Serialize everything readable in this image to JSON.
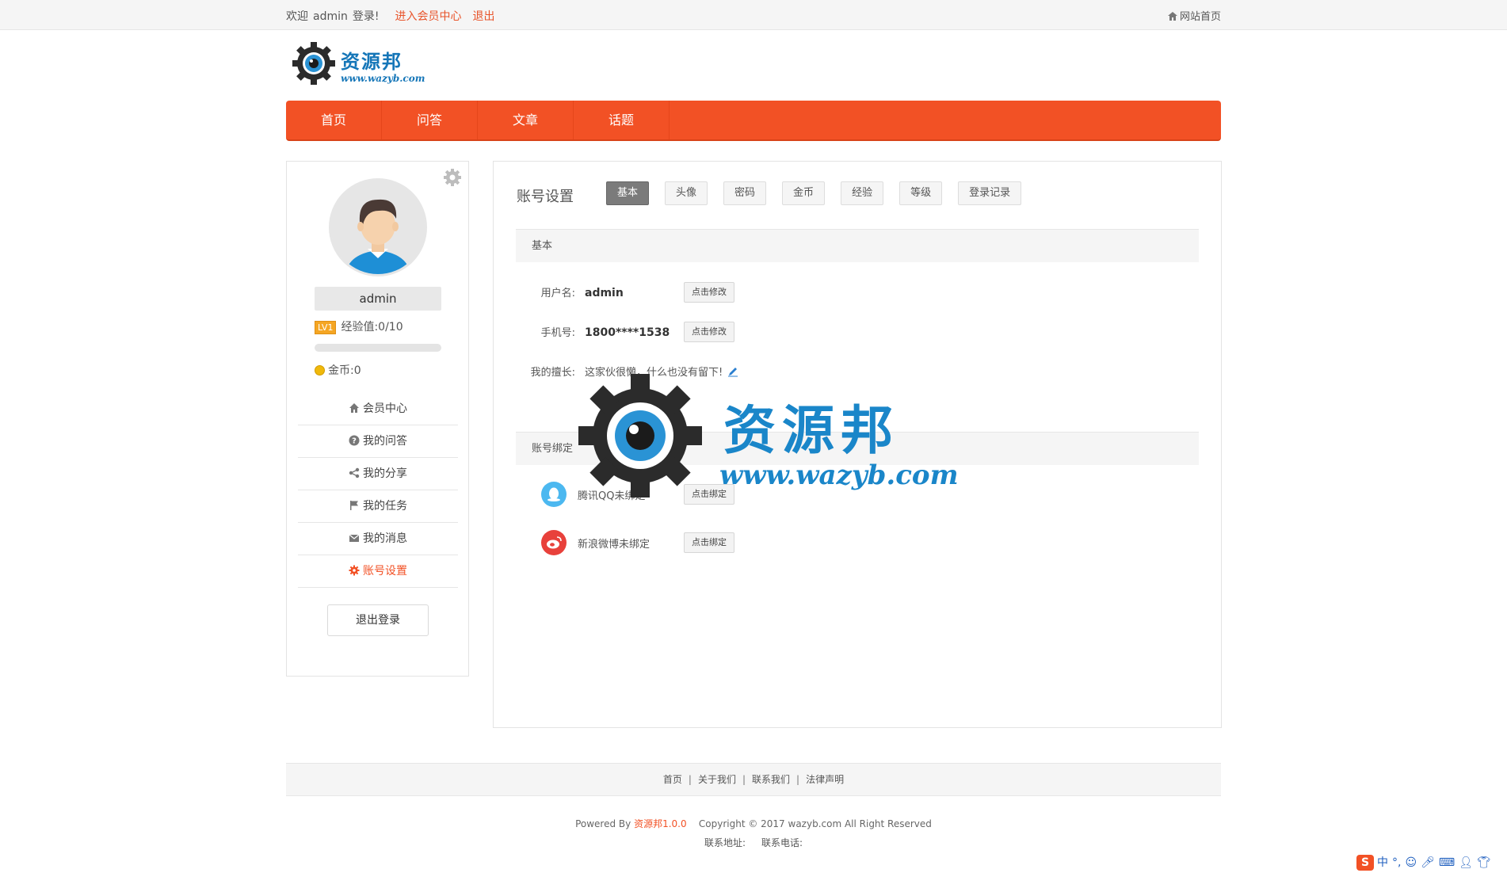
{
  "topbar": {
    "welcome": "欢迎",
    "user": "admin",
    "login_suffix": "登录!",
    "member_center_link": "进入会员中心",
    "logout_link": "退出",
    "site_home": "网站首页"
  },
  "logo": {
    "name": "资源邦",
    "url": "www.wazyb.com"
  },
  "nav": {
    "items": [
      {
        "label": "首页"
      },
      {
        "label": "问答"
      },
      {
        "label": "文章"
      },
      {
        "label": "话题"
      }
    ]
  },
  "sidebar": {
    "username": "admin",
    "level_badge": "LV1",
    "exp_label": "经验值:0/10",
    "exp_fraction": 0.0,
    "coin_label": "金币:0",
    "menu": [
      {
        "label": "会员中心",
        "icon": "home-icon"
      },
      {
        "label": "我的问答",
        "icon": "question-icon"
      },
      {
        "label": "我的分享",
        "icon": "share-icon"
      },
      {
        "label": "我的任务",
        "icon": "flag-icon"
      },
      {
        "label": "我的消息",
        "icon": "mail-icon"
      },
      {
        "label": "账号设置",
        "icon": "gear-icon",
        "active": true
      }
    ],
    "logout_button": "退出登录"
  },
  "main": {
    "title": "账号设置",
    "tabs": [
      {
        "label": "基本",
        "active": true
      },
      {
        "label": "头像"
      },
      {
        "label": "密码"
      },
      {
        "label": "金币"
      },
      {
        "label": "经验"
      },
      {
        "label": "等级"
      },
      {
        "label": "登录记录"
      }
    ],
    "basic_section": {
      "heading": "基本",
      "username_label": "用户名:",
      "username_value": "admin",
      "username_button": "点击修改",
      "phone_label": "手机号:",
      "phone_value": "1800****1538",
      "phone_button": "点击修改",
      "bio_label": "我的擅长:",
      "bio_value": "这家伙很懒，什么也没有留下!"
    },
    "binding_section": {
      "heading": "账号绑定",
      "qq_text": "腾讯QQ未绑定",
      "qq_button": "点击绑定",
      "weibo_text": "新浪微博未绑定",
      "weibo_button": "点击绑定"
    }
  },
  "watermark": {
    "text": "资源邦",
    "url": "www.wazyb.com"
  },
  "footer": {
    "links": [
      "首页",
      "关于我们",
      "联系我们",
      "法律声明"
    ],
    "powered_by": "Powered By",
    "brand": "资源邦1.0.0",
    "copyright": "Copyright © 2017 wazyb.com All Right Reserved",
    "address_label": "联系地址:",
    "phone_label": "联系电话:"
  },
  "ime": {
    "lang": "中",
    "punct": "°,"
  },
  "colors": {
    "accent": "#f25125",
    "brand_blue": "#1576b8"
  }
}
